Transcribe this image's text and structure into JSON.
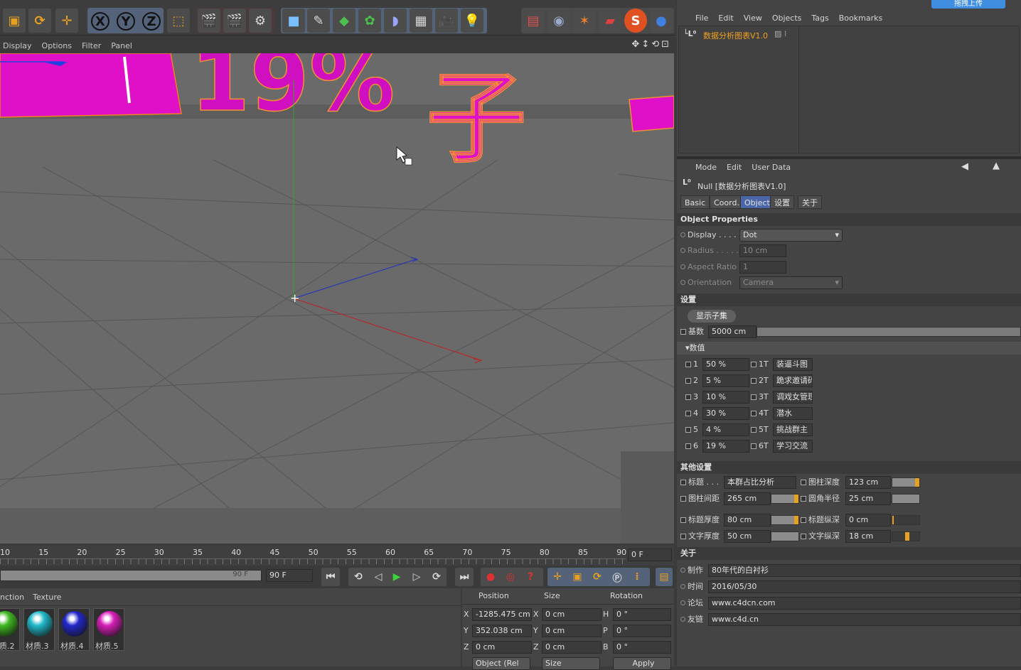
{
  "toolbar": {
    "icons": [
      "scale-tool-icon",
      "rotate-tool-icon",
      "move-tool-icon",
      "x-axis-icon",
      "y-axis-icon",
      "z-axis-icon",
      "coordinate-system-icon",
      "render-view-icon",
      "render-picture-icon",
      "render-settings-icon",
      "cube-icon",
      "spline-pen-icon",
      "nurbs-icon",
      "array-icon",
      "deformer-icon",
      "floor-icon",
      "camera-icon",
      "light-icon"
    ],
    "axis_labels": [
      "X",
      "Y",
      "Z"
    ]
  },
  "viewport": {
    "menu": [
      "Display",
      "Options",
      "Filter",
      "Panel"
    ],
    "scene_text": [
      "19%",
      "子"
    ]
  },
  "timeline": {
    "ticks": [
      "10",
      "15",
      "20",
      "25",
      "30",
      "35",
      "40",
      "45",
      "50",
      "55",
      "60",
      "65",
      "70",
      "75",
      "80",
      "85",
      "90"
    ],
    "current_frame": "0 F",
    "end_slider": "90 F",
    "end_field": "90 F"
  },
  "materials": {
    "tabs": [
      "nction",
      "Texture"
    ],
    "items": [
      {
        "label": "质.2",
        "color": "#3fb821"
      },
      {
        "label": "材质.3",
        "color": "#21b8c8"
      },
      {
        "label": "材质.4",
        "color": "#2228c8"
      },
      {
        "label": "材质.5",
        "color": "#d81fb8"
      }
    ]
  },
  "coords": {
    "headers": [
      "Position",
      "Size",
      "Rotation"
    ],
    "rows": [
      {
        "a": "X",
        "pos": "-1285.475 cm",
        "b": "X",
        "size": "0 cm",
        "c": "H",
        "rot": "0 °"
      },
      {
        "a": "Y",
        "pos": "352.038 cm",
        "b": "Y",
        "size": "0 cm",
        "c": "P",
        "rot": "0 °"
      },
      {
        "a": "Z",
        "pos": "0 cm",
        "b": "Z",
        "size": "0 cm",
        "c": "B",
        "rot": "0 °"
      }
    ],
    "mode_select": "Object (Rel",
    "size_select": "Size",
    "apply": "Apply"
  },
  "objects_panel": {
    "menu": [
      "File",
      "Edit",
      "View",
      "Objects",
      "Tags",
      "Bookmarks"
    ],
    "upload_button": "拖拽上传",
    "object_name": "数据分析图表V1.0"
  },
  "attributes": {
    "menu": [
      "Mode",
      "Edit",
      "User Data"
    ],
    "title": "Null [数据分析图表V1.0]",
    "tabs": [
      "Basic",
      "Coord.",
      "Object",
      "设置",
      "关于"
    ],
    "active_tab": "Object",
    "object_properties": "Object Properties",
    "display_label": "Display . . . . .",
    "display_value": "Dot",
    "radius_label": "Radius . . . . .",
    "radius_value": "10 cm",
    "aspect_label": "Aspect Ratio",
    "aspect_value": "1",
    "orientation_label": "Orientation",
    "orientation_value": "Camera",
    "settings_section": "设置",
    "show_children_button": "显示子集",
    "base_label": "基数",
    "base_value": "5000 cm",
    "values_section": "▾数值",
    "values": [
      {
        "n": "1",
        "v": "50 %",
        "t": "1T",
        "name": "装逼斗图"
      },
      {
        "n": "2",
        "v": "5 %",
        "t": "2T",
        "name": "跪求邀请码"
      },
      {
        "n": "3",
        "v": "10 %",
        "t": "3T",
        "name": "调戏女管理"
      },
      {
        "n": "4",
        "v": "30 %",
        "t": "4T",
        "name": "潜水"
      },
      {
        "n": "5",
        "v": "4 %",
        "t": "5T",
        "name": "挑战群主"
      },
      {
        "n": "6",
        "v": "19 %",
        "t": "6T",
        "name": "学习交流"
      }
    ],
    "other_section": "其他设置",
    "title_label": "标题 . . .",
    "title_value": "本群占比分析",
    "col_depth_label": "图柱深度",
    "col_depth_value": "123 cm",
    "col_gap_label": "图柱间距",
    "col_gap_value": "265 cm",
    "round_label": "圆角半径",
    "round_value": "25 cm",
    "title_thick_label": "标题厚度",
    "title_thick_value": "80 cm",
    "title_depth_label": "标题纵深",
    "title_depth_value": "0 cm",
    "text_thick_label": "文字厚度",
    "text_thick_value": "50 cm",
    "text_depth_label": "文字纵深",
    "text_depth_value": "18 cm",
    "about_section": "关于",
    "about": [
      {
        "k": "制作",
        "v": "80年代的白衬衫"
      },
      {
        "k": "时间",
        "v": "2016/05/30"
      },
      {
        "k": "论坛",
        "v": "www.c4dcn.com"
      },
      {
        "k": "友链",
        "v": "www.c4d.cn"
      }
    ]
  }
}
